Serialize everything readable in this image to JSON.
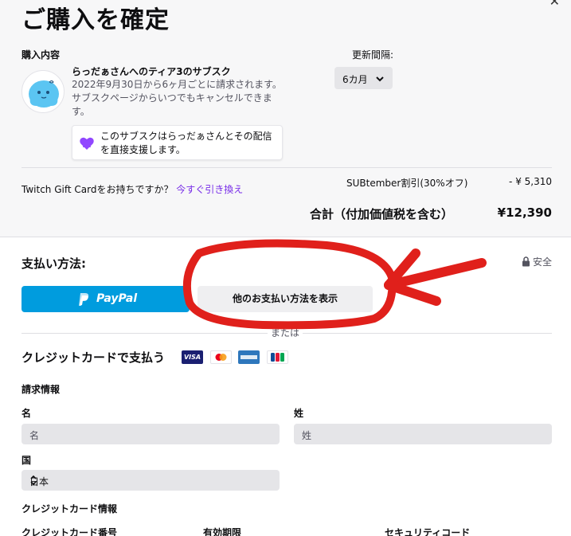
{
  "header": {
    "title": "ご購入を確定",
    "close_icon": "close-icon"
  },
  "purchase": {
    "section_label": "購入内容",
    "avatar_icon": "ghost-avatar-icon",
    "sub_title": "らっだぁさんへのティア3のサブスク",
    "description": "2022年9月30日から6ヶ月ごとに請求されます。サブスクページからいつでもキャンセルできます。",
    "support_icon": "purple-heart-icon",
    "support_text": "このサブスクはらっだぁさんとその配信を直接支援します。",
    "renew_label": "更新間隔:",
    "renew_value": "6カ月"
  },
  "summary": {
    "gift_question": "Twitch Gift Cardをお持ちですか？",
    "gift_link": "今すぐ引き換え",
    "discount_label": "SUBtember割引(30%オフ)",
    "discount_value": "- ¥ 5,310",
    "total_label": "合計（付加価値税を含む）",
    "total_value": "¥12,390"
  },
  "payment": {
    "label": "支払い方法:",
    "safe_label": "安全",
    "paypal_label": "PayPal",
    "other_button": "他のお支払い方法を表示",
    "or_text": "または",
    "cc_title": "クレジットカードで支払う",
    "visa_label": "VISA"
  },
  "billing": {
    "section_label": "請求情報",
    "first_name_label": "名",
    "first_name_placeholder": "名",
    "last_name_label": "姓",
    "last_name_placeholder": "姓",
    "country_label": "国",
    "country_value": "日本"
  },
  "card_info": {
    "section_label": "クレジットカード情報",
    "number_label": "クレジットカード番号",
    "expiry_label": "有効期限",
    "cvc_label": "セキュリティコード"
  },
  "colors": {
    "accent": "#772ce8",
    "paypal": "#009cde",
    "annotation": "#e0201b"
  }
}
